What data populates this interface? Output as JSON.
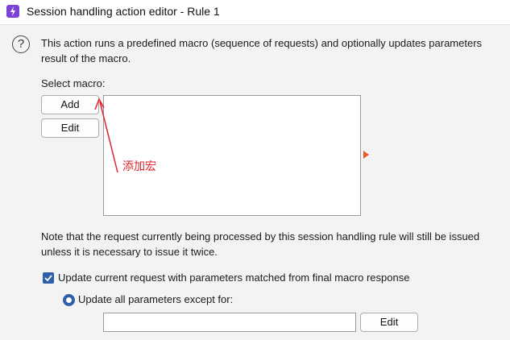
{
  "window": {
    "title": "Session handling action editor - Rule 1",
    "app_icon": "lightning-icon",
    "accent_color": "#7a42d6"
  },
  "help": {
    "icon": "question-circle-icon",
    "glyph": "?"
  },
  "description": {
    "line1": "This action runs a predefined macro (sequence of requests) and optionally updates parameters",
    "line2": "result of the macro."
  },
  "macro": {
    "select_label": "Select macro:",
    "add_label": "Add",
    "edit_label": "Edit",
    "items": []
  },
  "annotation": {
    "text": "添加宏",
    "color": "#e0242b"
  },
  "note": {
    "line1": "Note that the request currently being processed by this session handling rule will still be issued",
    "line2": "unless it is necessary to issue it twice."
  },
  "options": {
    "update_checkbox_label": "Update current request with parameters matched from final macro response",
    "update_checkbox_checked": true,
    "update_all_radio_label": "Update all parameters except for:",
    "update_all_radio_selected": true,
    "except_input_value": "",
    "edit_label": "Edit",
    "control_color": "#2f5fa8"
  }
}
